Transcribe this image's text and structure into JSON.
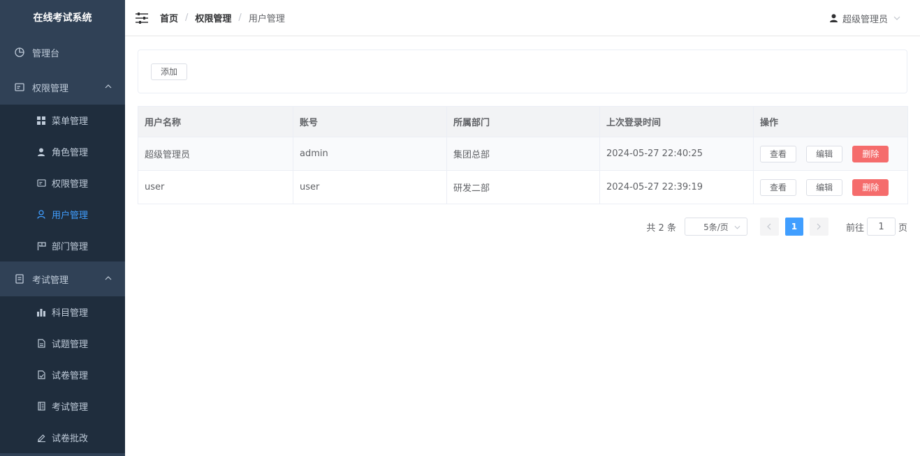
{
  "sidebar": {
    "brand": "在线考试系统",
    "dashboard": {
      "label": "管理台",
      "icon": "pie-chart-icon"
    },
    "auth_group": {
      "label": "权限管理",
      "icon": "id-card-icon",
      "expanded": true,
      "items": [
        {
          "label": "菜单管理",
          "icon": "grid-icon"
        },
        {
          "label": "角色管理",
          "icon": "person-icon"
        },
        {
          "label": "权限管理",
          "icon": "id-card-icon"
        },
        {
          "label": "用户管理",
          "icon": "user-outline-icon",
          "active": true
        },
        {
          "label": "部门管理",
          "icon": "flag-icon"
        }
      ]
    },
    "exam_group": {
      "label": "考试管理",
      "icon": "document-icon",
      "expanded": true,
      "items": [
        {
          "label": "科目管理",
          "icon": "bar-chart-icon"
        },
        {
          "label": "试题管理",
          "icon": "file-icon"
        },
        {
          "label": "试卷管理",
          "icon": "file-check-icon"
        },
        {
          "label": "考试管理",
          "icon": "notebook-icon"
        },
        {
          "label": "试卷批改",
          "icon": "pen-icon"
        }
      ]
    }
  },
  "header": {
    "breadcrumb": [
      "首页",
      "权限管理",
      "用户管理"
    ],
    "separator": "/",
    "user": "超级管理员"
  },
  "toolbar": {
    "add_label": "添加"
  },
  "table": {
    "columns": [
      "用户名称",
      "账号",
      "所属部门",
      "上次登录时间",
      "操作"
    ],
    "rows": [
      [
        "超级管理员",
        "admin",
        "集团总部",
        "2024-05-27 22:40:25"
      ],
      [
        "user",
        "user",
        "研发二部",
        "2024-05-27 22:39:19"
      ]
    ],
    "actions": {
      "view": "查看",
      "edit": "编辑",
      "delete": "删除"
    }
  },
  "pagination": {
    "total_text": "共 2 条",
    "page_size": "5条/页",
    "current_page": "1",
    "goto_label": "前往",
    "goto_value": "1",
    "page_suffix": "页"
  },
  "colors": {
    "sidebar_bg": "#304156",
    "submenu_bg": "#1f2d3d",
    "sidebar_text": "#bfcbd9",
    "accent": "#409eff",
    "danger": "#f56c6c"
  }
}
